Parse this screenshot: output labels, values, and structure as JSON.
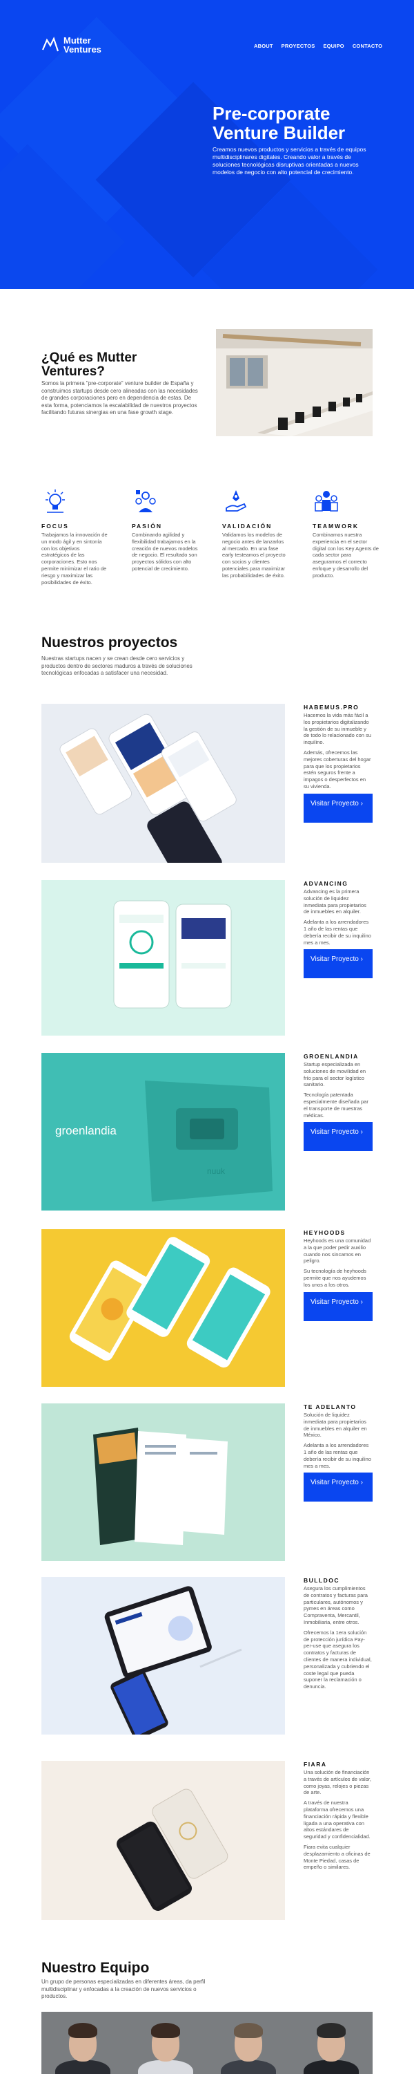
{
  "brand": {
    "line1": "Mutter",
    "line2": "Ventures"
  },
  "nav": [
    {
      "label": "ABOUT"
    },
    {
      "label": "PROYECTOS"
    },
    {
      "label": "EQUIPO"
    },
    {
      "label": "CONTACTO"
    }
  ],
  "hero": {
    "title": "Pre-corporate Venture Builder",
    "text": "Creamos nuevos productos y servicios a través de equipos multidisciplinares digitales. Creando valor a través de soluciones tecnológicas disruptivas orientadas a nuevos modelos de negocio con alto potencial de crecimiento."
  },
  "about": {
    "title": "¿Qué es Mutter Ventures?",
    "text": "Somos la primera \"pre-corporate\" venture builder de España y construimos startups desde cero alineadas con las necesidades de grandes corporaciones pero en dependencia de estas. De esta forma, potenciamos la escalabilidad de nuestros proyectos facilitando futuras sinergias en una fase growth stage."
  },
  "values": [
    {
      "title": "FOCUS",
      "icon": "idea-icon",
      "text": "Trabajamos la innovación de un modo ágil y en sintonía con los objetivos estratégicos de las corporaciones. Esto nos permite minimizar el ratio de riesgo y maximizar las posibilidades de éxito."
    },
    {
      "title": "PASIÓN",
      "icon": "team-badge-icon",
      "text": "Combinando agilidad y flexibilidad trabajamos en la creación de nuevos modelos de negocio. El resultado son proyectos sólidos con alto potencial de crecimiento."
    },
    {
      "title": "VALIDACIÓN",
      "icon": "hand-rocket-icon",
      "text": "Validamos los modelos de negocio antes de lanzarlos al mercado. En una fase early testeamos el proyecto con socios y clientes potenciales para maximizar las probabilidades de éxito."
    },
    {
      "title": "TEAMWORK",
      "icon": "group-icon",
      "text": "Combinamos nuestra experiencia en el sector digital con los Key Agents de cada sector para asegurarnos el correcto enfoque y desarrollo del producto."
    }
  ],
  "projects_section": {
    "title": "Nuestros proyectos",
    "subtitle": "Nuestras startups nacen y se crean desde cero servicios y productos dentro de sectores maduros a través de soluciones tecnológicas enfocadas a satisfacer una necesidad."
  },
  "projects": [
    {
      "name": "HABEMUS.PRO",
      "p1": "Hacemos la vida más fácil a los propietarios digitalizando la gestión de su inmueble y de todo lo relacionado con su inquilino.",
      "p2": "Además, ofrecemos las mejores coberturas del hogar para que los propietarios estén seguros frente a impagos o desperfectos en su vivienda.",
      "button": "Visitar Proyecto ›"
    },
    {
      "name": "ADVANCING",
      "p1": "Advancing es la primera solución de liquidez inmediata para propietarios de inmuebles en alquiler.",
      "p2": "Adelanta a los arrendadores 1 año de las rentas que debería recibir de su inquilino mes a mes.",
      "button": "Visitar Proyecto ›"
    },
    {
      "name": "GROENLANDIA",
      "p1": "Startup especializada en soluciones de movilidad en frío para el sector logístico sanitario.",
      "p2": "Tecnología patentada especialmente diseñada par el transporte de muestras médicas.",
      "button": "Visitar Proyecto ›",
      "logo": "groenlandia",
      "device": "nuuk"
    },
    {
      "name": "HEYHOODS",
      "p1": "Heyhoods es una comunidad a la que poder pedir auxilio cuando nos sincamos en peligro.",
      "p2": "Su tecnología de heyhoods permite que nos ayudemos los unos a los otros.",
      "button": "Visitar Proyecto ›"
    },
    {
      "name": "TE ADELANTO",
      "p1": "Solución de liquidez inmediata para propietarios de inmuebles en alquiler en México.",
      "p2": "Adelanta a los arrendadores 1 año de las rentas que debería recibir de su inquilino mes a mes.",
      "button": "Visitar Proyecto ›"
    },
    {
      "name": "BULLDOC",
      "p1": "Asegura los cumplimientos de contratos y facturas para particulares, autónomos y pymes en áreas como Compraventa, Mercantil, Inmobiliaria, entre otros.",
      "p2": "Ofrecemos la 1era solución de protección jurídica Pay-per-use que asegura los contratos y facturas de clientes de manera individual, personalizada y cubriendo el coste legal que pueda suponer la reclamación o denuncia."
    },
    {
      "name": "FIARA",
      "p1": "Una solución de financiación a través de artículos de valor, como joyas, relojes o piezas de arte.",
      "p2": "A través de nuestra plataforma ofrecemos una financiación rápida y flexible ligada a una operativa con altos estándares de seguridad y confidencialidad.",
      "p3": "Fiara evita cualquier desplazamiento a oficinas de Monte Piedad, casas de empeño o similares."
    }
  ],
  "team": {
    "title": "Nuestro Equipo",
    "subtitle": "Un grupo de personas especializadas en diferentes áreas, da perfil multidisciplinar y enfocadas a la creación de nuevos servicios o productos."
  }
}
